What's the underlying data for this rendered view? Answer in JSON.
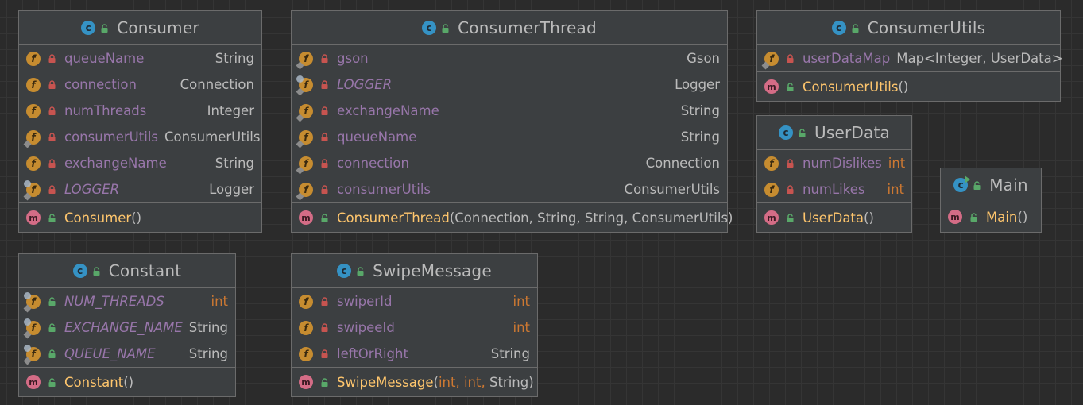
{
  "icons": {
    "class": "class-icon",
    "field": "field-icon",
    "method": "method-icon",
    "private": "lock-icon",
    "public": "unlock-icon"
  },
  "colors": {
    "background": "#2b2b2b",
    "box": "#3c3f41",
    "field_name": "#9876aa",
    "method_name": "#ffc66d",
    "keyword": "#cc7832",
    "text": "#bbbbbb"
  },
  "classes": {
    "consumer": {
      "name": "Consumer",
      "fields": [
        {
          "name": "queueName",
          "type": "String"
        },
        {
          "name": "connection",
          "type": "Connection"
        },
        {
          "name": "numThreads",
          "type": "Integer"
        },
        {
          "name": "consumerUtils",
          "type": "ConsumerUtils"
        },
        {
          "name": "exchangeName",
          "type": "String"
        },
        {
          "name": "LOGGER",
          "type": "Logger"
        }
      ],
      "method": {
        "name": "Consumer",
        "params": "()"
      }
    },
    "consumerThread": {
      "name": "ConsumerThread",
      "fields": [
        {
          "name": "gson",
          "type": "Gson"
        },
        {
          "name": "LOGGER",
          "type": "Logger"
        },
        {
          "name": "exchangeName",
          "type": "String"
        },
        {
          "name": "queueName",
          "type": "String"
        },
        {
          "name": "connection",
          "type": "Connection"
        },
        {
          "name": "consumerUtils",
          "type": "ConsumerUtils"
        }
      ],
      "method": {
        "name": "ConsumerThread",
        "params": "(Connection, String, String, ConsumerUtils)"
      }
    },
    "consumerUtils": {
      "name": "ConsumerUtils",
      "fields": [
        {
          "name": "userDataMap",
          "type_a": "Map<Integer,",
          "type_b": "UserData>"
        }
      ],
      "method": {
        "name": "ConsumerUtils",
        "params": "()"
      }
    },
    "userData": {
      "name": "UserData",
      "fields": [
        {
          "name": "numDislikes",
          "type": "int"
        },
        {
          "name": "numLikes",
          "type": "int"
        }
      ],
      "method": {
        "name": "UserData",
        "params": "()"
      }
    },
    "main": {
      "name": "Main",
      "method": {
        "name": "Main",
        "params": "()"
      }
    },
    "constant": {
      "name": "Constant",
      "fields": [
        {
          "name": "NUM_THREADS",
          "type": "int"
        },
        {
          "name": "EXCHANGE_NAME",
          "type": "String"
        },
        {
          "name": "QUEUE_NAME",
          "type": "String"
        }
      ],
      "method": {
        "name": "Constant",
        "params": "()"
      }
    },
    "swipeMessage": {
      "name": "SwipeMessage",
      "fields": [
        {
          "name": "swiperId",
          "type": "int"
        },
        {
          "name": "swipeeId",
          "type": "int"
        },
        {
          "name": "leftOrRight",
          "type": "String"
        }
      ],
      "method": {
        "name": "SwipeMessage",
        "param_a": "int,",
        "param_b": "int,",
        "param_c": "String"
      }
    }
  }
}
